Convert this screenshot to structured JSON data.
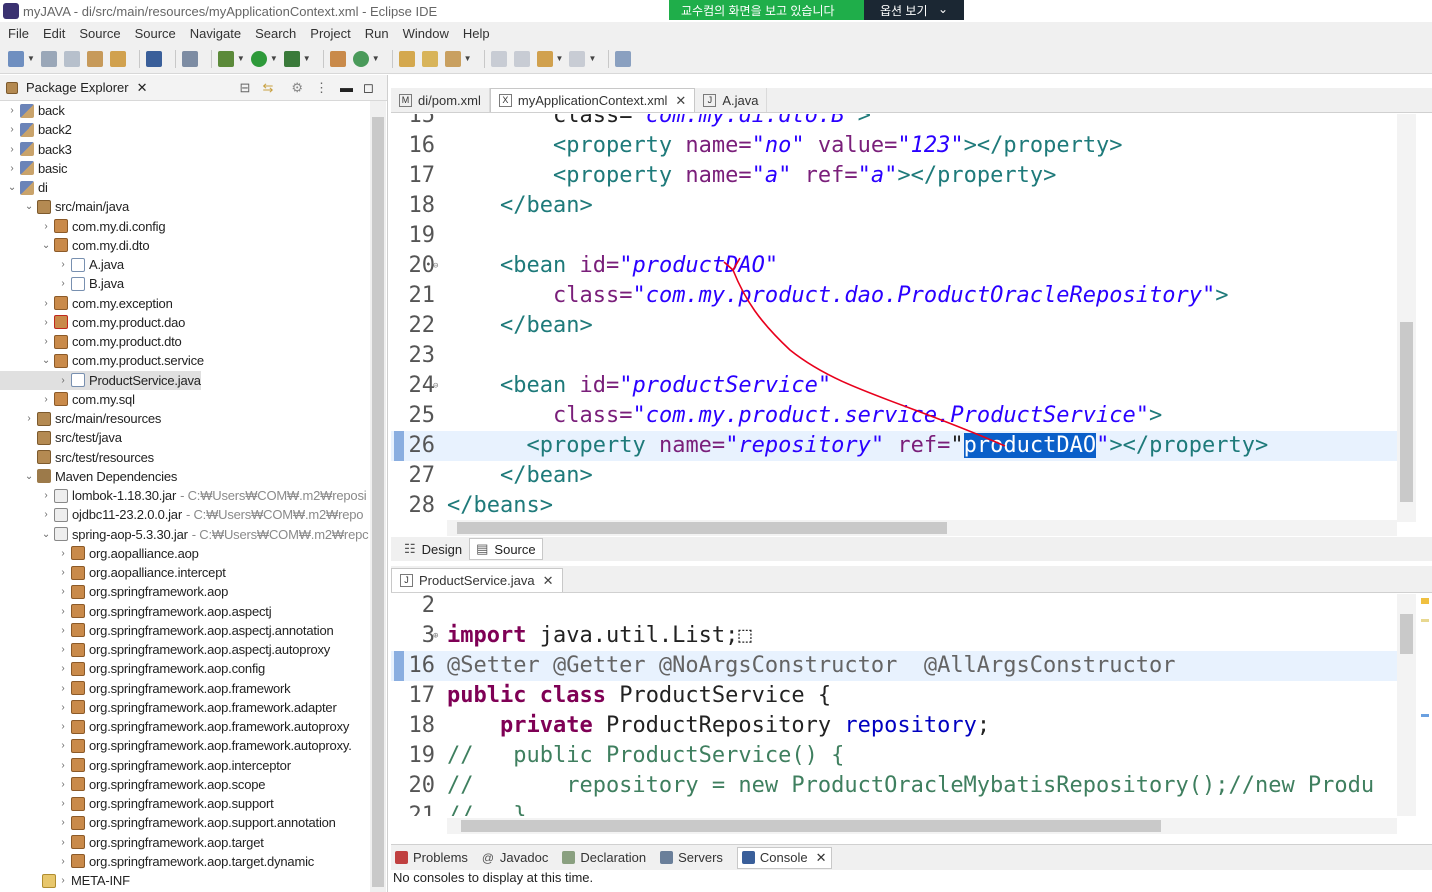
{
  "window": {
    "title": "myJAVA - di/src/main/resources/myApplicationContext.xml - Eclipse IDE"
  },
  "banner": {
    "message": "교수컴의 화면을 보고 있습니다",
    "options_label": "옵션 보기"
  },
  "menu": [
    "File",
    "Edit",
    "Source",
    "Source",
    "Navigate",
    "Search",
    "Project",
    "Run",
    "Window",
    "Help"
  ],
  "package_explorer": {
    "title": "Package Explorer",
    "tree": [
      {
        "label": "back",
        "icon": "proj",
        "indent": 0,
        "twisty": "collapsed"
      },
      {
        "label": "back2",
        "icon": "proj",
        "indent": 0,
        "twisty": "collapsed"
      },
      {
        "label": "back3",
        "icon": "proj",
        "indent": 0,
        "twisty": "collapsed"
      },
      {
        "label": "basic",
        "icon": "proj",
        "indent": 0,
        "twisty": "collapsed"
      },
      {
        "label": "di",
        "icon": "proj",
        "indent": 0,
        "twisty": "expanded"
      },
      {
        "label": "src/main/java",
        "icon": "srcf",
        "indent": 1,
        "twisty": "expanded"
      },
      {
        "label": "com.my.di.config",
        "icon": "pkg",
        "indent": 2,
        "twisty": "collapsed"
      },
      {
        "label": "com.my.di.dto",
        "icon": "pkg",
        "indent": 2,
        "twisty": "expanded"
      },
      {
        "label": "A.java",
        "icon": "java",
        "indent": 3,
        "twisty": "collapsed"
      },
      {
        "label": "B.java",
        "icon": "java",
        "indent": 3,
        "twisty": "collapsed"
      },
      {
        "label": "com.my.exception",
        "icon": "pkg",
        "indent": 2,
        "twisty": "collapsed"
      },
      {
        "label": "com.my.product.dao",
        "icon": "pkgx",
        "indent": 2,
        "twisty": "collapsed"
      },
      {
        "label": "com.my.product.dto",
        "icon": "pkg",
        "indent": 2,
        "twisty": "collapsed"
      },
      {
        "label": "com.my.product.service",
        "icon": "pkg",
        "indent": 2,
        "twisty": "expanded"
      },
      {
        "label": "ProductService.java",
        "icon": "java",
        "indent": 3,
        "twisty": "collapsed",
        "selected": true
      },
      {
        "label": "com.my.sql",
        "icon": "pkg",
        "indent": 2,
        "twisty": "collapsed"
      },
      {
        "label": "src/main/resources",
        "icon": "srcf",
        "indent": 1,
        "twisty": "collapsed"
      },
      {
        "label": "src/test/java",
        "icon": "srcf",
        "indent": 1,
        "twisty": "none"
      },
      {
        "label": "src/test/resources",
        "icon": "srcf",
        "indent": 1,
        "twisty": "none"
      },
      {
        "label": "Maven Dependencies",
        "icon": "libc",
        "indent": 1,
        "twisty": "expanded"
      },
      {
        "label": "lombok-1.18.30.jar",
        "icon": "jar",
        "indent": 2,
        "twisty": "collapsed",
        "path": "- C:₩Users₩COM₩.m2₩reposi"
      },
      {
        "label": "ojdbc11-23.2.0.0.jar",
        "icon": "jar",
        "indent": 2,
        "twisty": "collapsed",
        "path": "- C:₩Users₩COM₩.m2₩repo"
      },
      {
        "label": "spring-aop-5.3.30.jar",
        "icon": "jar",
        "indent": 2,
        "twisty": "expanded",
        "path": "- C:₩Users₩COM₩.m2₩repc"
      },
      {
        "label": "org.aopalliance.aop",
        "icon": "pkg",
        "indent": 3,
        "twisty": "collapsed"
      },
      {
        "label": "org.aopalliance.intercept",
        "icon": "pkg",
        "indent": 3,
        "twisty": "collapsed"
      },
      {
        "label": "org.springframework.aop",
        "icon": "pkg",
        "indent": 3,
        "twisty": "collapsed"
      },
      {
        "label": "org.springframework.aop.aspectj",
        "icon": "pkg",
        "indent": 3,
        "twisty": "collapsed"
      },
      {
        "label": "org.springframework.aop.aspectj.annotation",
        "icon": "pkg",
        "indent": 3,
        "twisty": "collapsed"
      },
      {
        "label": "org.springframework.aop.aspectj.autoproxy",
        "icon": "pkg",
        "indent": 3,
        "twisty": "collapsed"
      },
      {
        "label": "org.springframework.aop.config",
        "icon": "pkg",
        "indent": 3,
        "twisty": "collapsed"
      },
      {
        "label": "org.springframework.aop.framework",
        "icon": "pkg",
        "indent": 3,
        "twisty": "collapsed"
      },
      {
        "label": "org.springframework.aop.framework.adapter",
        "icon": "pkg",
        "indent": 3,
        "twisty": "collapsed"
      },
      {
        "label": "org.springframework.aop.framework.autoproxy",
        "icon": "pkg",
        "indent": 3,
        "twisty": "collapsed"
      },
      {
        "label": "org.springframework.aop.framework.autoproxy.",
        "icon": "pkg",
        "indent": 3,
        "twisty": "collapsed"
      },
      {
        "label": "org.springframework.aop.interceptor",
        "icon": "pkg",
        "indent": 3,
        "twisty": "collapsed"
      },
      {
        "label": "org.springframework.aop.scope",
        "icon": "pkg",
        "indent": 3,
        "twisty": "collapsed"
      },
      {
        "label": "org.springframework.aop.support",
        "icon": "pkg",
        "indent": 3,
        "twisty": "collapsed"
      },
      {
        "label": "org.springframework.aop.support.annotation",
        "icon": "pkg",
        "indent": 3,
        "twisty": "collapsed"
      },
      {
        "label": "org.springframework.aop.target",
        "icon": "pkg",
        "indent": 3,
        "twisty": "collapsed"
      },
      {
        "label": "org.springframework.aop.target.dynamic",
        "icon": "pkg",
        "indent": 3,
        "twisty": "collapsed"
      },
      {
        "label": "META-INF",
        "icon": "fold",
        "indent": 3,
        "twisty": "collapsed"
      }
    ]
  },
  "editor_tabs": [
    {
      "label": "di/pom.xml",
      "icon": "M",
      "active": false,
      "close": false
    },
    {
      "label": "myApplicationContext.xml",
      "icon": "X",
      "active": true,
      "close": true
    },
    {
      "label": "A.java",
      "icon": "J",
      "active": false,
      "close": false
    }
  ],
  "xml_lines": [
    {
      "n": "15",
      "cur": false,
      "parts": [
        [
          "        ",
          ""
        ],
        [
          "class=",
          ""
        ],
        [
          "\"com.my.di.dto.B\"",
          "val"
        ],
        [
          ">",
          "tag"
        ]
      ]
    },
    {
      "n": "16",
      "cur": false,
      "parts": [
        [
          "        ",
          ""
        ],
        [
          "<property",
          "tag"
        ],
        [
          " name=",
          "att"
        ],
        [
          "\"no\"",
          "val"
        ],
        [
          " value=",
          "att"
        ],
        [
          "\"123\"",
          "val"
        ],
        [
          "></property>",
          "tag"
        ]
      ]
    },
    {
      "n": "17",
      "cur": false,
      "parts": [
        [
          "        ",
          ""
        ],
        [
          "<property",
          "tag"
        ],
        [
          " name=",
          "att"
        ],
        [
          "\"a\"",
          "val"
        ],
        [
          " ref=",
          "att"
        ],
        [
          "\"a\"",
          "val"
        ],
        [
          "></property>",
          "tag"
        ]
      ]
    },
    {
      "n": "18",
      "cur": false,
      "parts": [
        [
          "    ",
          ""
        ],
        [
          "</bean>",
          "tag"
        ]
      ]
    },
    {
      "n": "19",
      "cur": false,
      "parts": [
        [
          "",
          ""
        ]
      ]
    },
    {
      "n": "20",
      "cur": false,
      "fold": "⊖",
      "parts": [
        [
          "    ",
          ""
        ],
        [
          "<bean",
          "tag"
        ],
        [
          " id=",
          "att"
        ],
        [
          "\"productDAO\"",
          "val"
        ]
      ]
    },
    {
      "n": "21",
      "cur": false,
      "parts": [
        [
          "        ",
          ""
        ],
        [
          "class=",
          "att"
        ],
        [
          "\"com.my.product.dao.ProductOracleRepository\"",
          "val"
        ],
        [
          ">",
          "tag"
        ]
      ]
    },
    {
      "n": "22",
      "cur": false,
      "parts": [
        [
          "    ",
          ""
        ],
        [
          "</bean>",
          "tag"
        ]
      ]
    },
    {
      "n": "23",
      "cur": false,
      "parts": [
        [
          "",
          ""
        ]
      ]
    },
    {
      "n": "24",
      "cur": false,
      "fold": "⊖",
      "parts": [
        [
          "    ",
          ""
        ],
        [
          "<bean",
          "tag"
        ],
        [
          " id=",
          "att"
        ],
        [
          "\"productService\"",
          "val"
        ]
      ]
    },
    {
      "n": "25",
      "cur": false,
      "parts": [
        [
          "        ",
          ""
        ],
        [
          "class=",
          "att"
        ],
        [
          "\"com.my.product.service.ProductService\"",
          "val"
        ],
        [
          ">",
          "tag"
        ]
      ]
    },
    {
      "n": "26",
      "cur": true,
      "parts": [
        [
          "      ",
          ""
        ],
        [
          "<property",
          "tag"
        ],
        [
          " name=",
          "att"
        ],
        [
          "\"repository\"",
          "val"
        ],
        [
          " ref=",
          "att"
        ],
        [
          "\"",
          ""
        ],
        [
          "productDAO",
          "hl"
        ],
        [
          "\"",
          "val"
        ],
        [
          "></property>",
          "tag"
        ]
      ]
    },
    {
      "n": "27",
      "cur": false,
      "parts": [
        [
          "    ",
          ""
        ],
        [
          "</bean>",
          "tag"
        ]
      ]
    },
    {
      "n": "28",
      "cur": false,
      "parts": [
        [
          "</beans>",
          "tag"
        ]
      ]
    }
  ],
  "design_tabs": [
    {
      "label": "Design",
      "active": false
    },
    {
      "label": "Source",
      "active": true
    }
  ],
  "java_tab": {
    "label": "ProductService.java"
  },
  "java_lines": [
    {
      "n": "2",
      "cur": false,
      "parts": [
        [
          "",
          ""
        ]
      ]
    },
    {
      "n": "3",
      "cur": false,
      "fold": "⊕",
      "parts": [
        [
          "import",
          "kw"
        ],
        [
          " java.util.List;",
          ""
        ],
        [
          "⬚",
          ""
        ]
      ]
    },
    {
      "n": "16",
      "cur": true,
      "parts": [
        [
          "@Setter @Getter @NoArgsConstructor  @AllArgsConstructor",
          "ann"
        ]
      ]
    },
    {
      "n": "17",
      "cur": false,
      "parts": [
        [
          "public class",
          "kw"
        ],
        [
          " ProductService {",
          ""
        ]
      ]
    },
    {
      "n": "18",
      "cur": false,
      "parts": [
        [
          "    ",
          ""
        ],
        [
          "private",
          "kw"
        ],
        [
          " ProductRepository ",
          ""
        ],
        [
          "repository",
          "fld"
        ],
        [
          ";",
          ""
        ]
      ]
    },
    {
      "n": "19",
      "cur": false,
      "parts": [
        [
          "//   public ProductService() {",
          "cm"
        ]
      ]
    },
    {
      "n": "20",
      "cur": false,
      "parts": [
        [
          "//       repository = new ProductOracleMybatisRepository();//new Produ",
          "cm"
        ]
      ]
    },
    {
      "n": "21",
      "cur": false,
      "parts": [
        [
          "//   }",
          "cm"
        ]
      ]
    }
  ],
  "bottom_tabs": [
    "Problems",
    "Javadoc",
    "Declaration",
    "Servers",
    "Console"
  ],
  "console": {
    "message": "No consoles to display at this time."
  },
  "colors": {
    "annotation_arrow": "#e8001c",
    "selection": "#0a5fc9",
    "current_line": "#e8f2fe"
  }
}
